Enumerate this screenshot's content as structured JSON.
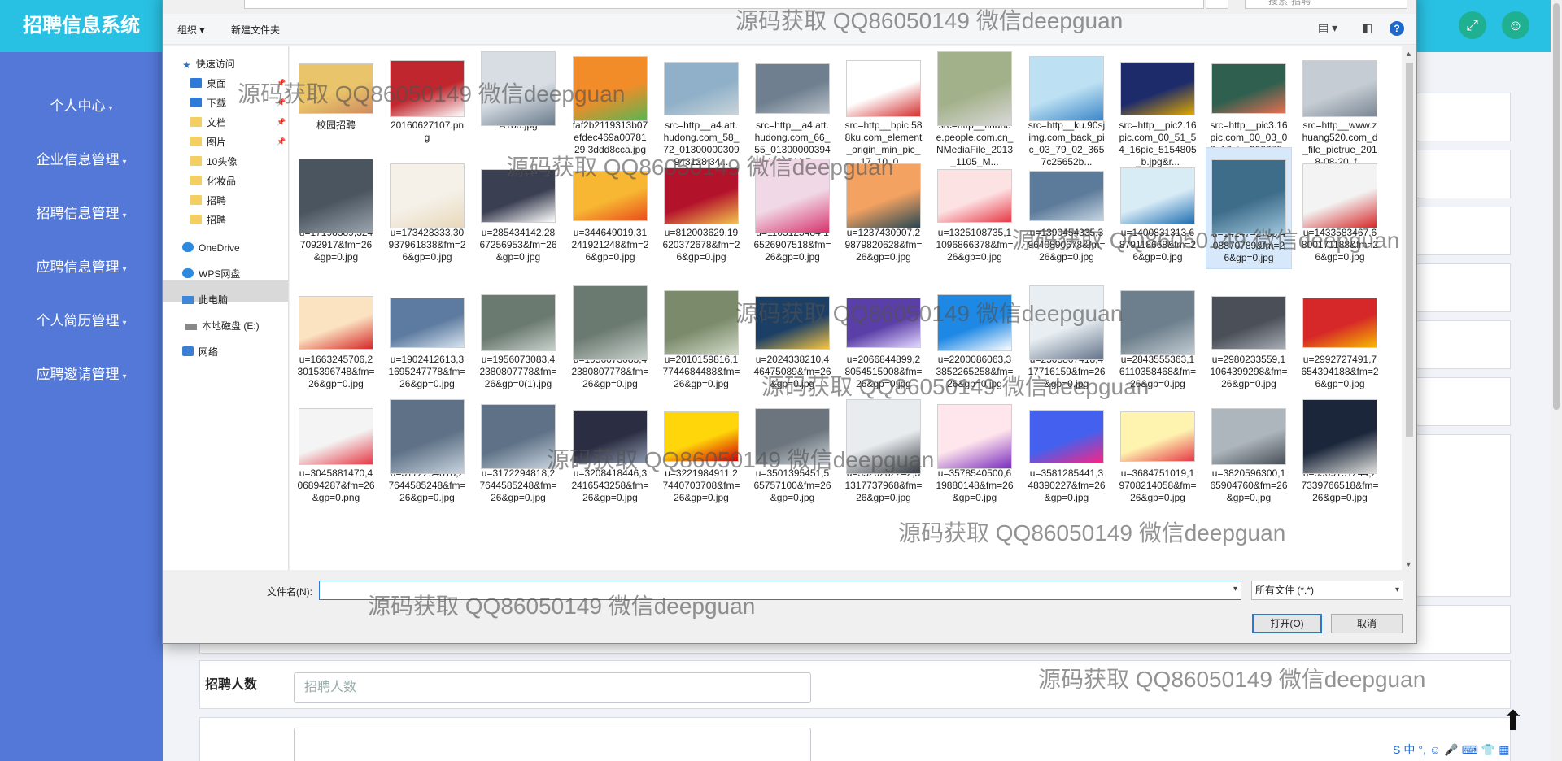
{
  "app": {
    "title": "招聘信息系统",
    "header_icons": [
      "fullscreen-icon",
      "user-icon"
    ],
    "sidebar": [
      {
        "label": "个人中心"
      },
      {
        "label": "企业信息管理"
      },
      {
        "label": "招聘信息管理"
      },
      {
        "label": "应聘信息管理"
      },
      {
        "label": "个人简历管理"
      },
      {
        "label": "应聘邀请管理"
      }
    ],
    "caret": "▾",
    "form": {
      "recruit_count_label": "招聘人数",
      "recruit_count_placeholder": "招聘人数"
    },
    "upload_icon": "⬆",
    "ime": [
      "S",
      "中",
      "°,",
      "☺",
      "🎤",
      "⌨",
      "👕",
      "▦"
    ]
  },
  "dialog": {
    "search_placeholder": "搜索\"招聘\"",
    "toolbar": {
      "organize": "组织 ▾",
      "new_folder": "新建文件夹"
    },
    "nav": [
      {
        "label": "快速访问",
        "icon": "star-icon",
        "pinned": false
      },
      {
        "label": "桌面",
        "icon": "desktop-icon",
        "pinned": true
      },
      {
        "label": "下载",
        "icon": "download-icon",
        "pinned": true
      },
      {
        "label": "文档",
        "icon": "document-icon",
        "pinned": true
      },
      {
        "label": "图片",
        "icon": "picture-icon",
        "pinned": true
      },
      {
        "label": "10头像",
        "icon": "folder-icon",
        "pinned": false
      },
      {
        "label": "化妆品",
        "icon": "folder-icon",
        "pinned": false
      },
      {
        "label": "招聘",
        "icon": "folder-icon",
        "pinned": false
      },
      {
        "label": "招聘",
        "icon": "folder-icon",
        "pinned": false
      },
      {
        "label": "OneDrive",
        "icon": "onedrive-icon",
        "pinned": false
      },
      {
        "label": "WPS网盘",
        "icon": "cloud-icon",
        "pinned": false
      },
      {
        "label": "此电脑",
        "icon": "computer-icon",
        "pinned": false
      },
      {
        "label": "本地磁盘 (E:)",
        "icon": "drive-icon",
        "pinned": false
      },
      {
        "label": "网络",
        "icon": "network-icon",
        "pinned": false
      }
    ],
    "files": [
      {
        "name": "校园招聘",
        "color": "#e9c46a",
        "sub": "#d08c60"
      },
      {
        "name": "20160627107.png",
        "color": "#c0262d",
        "sub": "#ffffff"
      },
      {
        "name": "A188.jpg",
        "color": "#d7dde3",
        "sub": "#6a7b8c"
      },
      {
        "name": "faf2b2119313b07efdec469a0078129 3ddd8cca.jpg",
        "color": "#f28c28",
        "sub": "#5ab552"
      },
      {
        "name": "src=http__a4.att.hudong.com_58_72_01300000309943128 34...",
        "color": "#8fb0c8",
        "sub": "#c9d4da"
      },
      {
        "name": "src=http__a4.att.hudong.com_66_55_013000003944181511 7...",
        "color": "#6f7f8f",
        "sub": "#b8c0c8"
      },
      {
        "name": "src=http__bpic.588ku.com_element_origin_min_pic_17_10_0...",
        "color": "#ffffff",
        "sub": "#d32f2f"
      },
      {
        "name": "src=http__finance.people.com.cn_NMediaFile_2013_1105_M...",
        "color": "#a3b18a",
        "sub": "#d9d9d9"
      },
      {
        "name": "src=http__ku.90sjimg.com_back_pic_03_79_02_3657c25652b...",
        "color": "#bde0f2",
        "sub": "#3a86c8"
      },
      {
        "name": "src=http__pic2.16pic.com_00_51_54_16pic_5154805_b.jpg&r...",
        "color": "#1d2b6b",
        "sub": "#e0a800"
      },
      {
        "name": "src=http__pic3.16pic.com_00_03_08_16pic_308378_b.jpg&ref...",
        "color": "#2f5f4f",
        "sub": "#e76f51"
      },
      {
        "name": "src=http__www.zhuang520.com_d_file_pictrue_2018-08-20_f...",
        "color": "#c5ccd3",
        "sub": "#7a8794"
      },
      {
        "name": "u=17198389,3247092917&fm=26&gp=0.jpg",
        "color": "#4a5560",
        "sub": "#9aa5ae"
      },
      {
        "name": "u=173428333,30937961838&fm=26&gp=0.jpg",
        "color": "#f5f0e8",
        "sub": "#e8d8b8"
      },
      {
        "name": "u=285434142,2867256953&fm=26&gp=0.jpg",
        "color": "#3b3f52",
        "sub": "#ffffff"
      },
      {
        "name": "u=344649019,31241921248&fm=26&gp=0.jpg",
        "color": "#f7b733",
        "sub": "#e94e1b"
      },
      {
        "name": "u=812003629,19620372678&fm=26&gp=0.jpg",
        "color": "#b3122b",
        "sub": "#f2c14e"
      },
      {
        "name": "u=1105125484,16526907518&fm=26&gp=0.jpg",
        "color": "#f1d8e6",
        "sub": "#d6336c"
      },
      {
        "name": "u=1237430907,29879820628&fm=26&gp=0.jpg",
        "color": "#f4a261",
        "sub": "#264653"
      },
      {
        "name": "u=1325108735,11096866378&fm=26&gp=0.jpg",
        "color": "#fde2e4",
        "sub": "#e63946"
      },
      {
        "name": "u=1390454335,39640890678&fm=26&gp=0.jpg",
        "color": "#5c7a99",
        "sub": "#c4d4e2"
      },
      {
        "name": "u=1400831313,6879118668&fm=26&gp=0.jpg",
        "color": "#d8ecf6",
        "sub": "#1f6fb2"
      },
      {
        "name": "u=1414742736,408870789&fm=26&gp=0.jpg",
        "color": "#3e6d8a",
        "sub": "#9fc5db",
        "selected": true
      },
      {
        "name": "u=1433583467,6800171188&fm=26&gp=0.jpg",
        "color": "#f3f3f3",
        "sub": "#d62828"
      },
      {
        "name": "u=1663245706,23015396748&fm=26&gp=0.jpg",
        "color": "#fbe3c2",
        "sub": "#d62828"
      },
      {
        "name": "u=1902412613,31695247778&fm=26&gp=0.jpg",
        "color": "#5d7ba0",
        "sub": "#d7e3ef"
      },
      {
        "name": "u=1956073083,42380807778&fm=26&gp=0(1).jpg",
        "color": "#6b7a70",
        "sub": "#c8d1cc"
      },
      {
        "name": "u=1956073083,42380807778&fm=26&gp=0.jpg",
        "color": "#6b7a70",
        "sub": "#c8d1cc"
      },
      {
        "name": "u=2010159816,17744684488&fm=26&gp=0.jpg",
        "color": "#7a8a6a",
        "sub": "#d3dbc9"
      },
      {
        "name": "u=2024338210,446475089&fm=26&gp=0.jpg",
        "color": "#1c3f66",
        "sub": "#f4c542"
      },
      {
        "name": "u=2066844899,28054515908&fm=26&gp=0.jpg",
        "color": "#5b3fa8",
        "sub": "#e3d7ff"
      },
      {
        "name": "u=2200086063,33852265258&fm=26&gp=0.jpg",
        "color": "#1e88e5",
        "sub": "#ffffff"
      },
      {
        "name": "u=2503807418,417716159&fm=26&gp=0.jpg",
        "color": "#e8eef2",
        "sub": "#64748b"
      },
      {
        "name": "u=2843555363,16110358468&fm=26&gp=0.jpg",
        "color": "#6d7f8c",
        "sub": "#c2ccd3"
      },
      {
        "name": "u=2980233559,11064399298&fm=26&gp=0.jpg",
        "color": "#4a4f58",
        "sub": "#a8adb5"
      },
      {
        "name": "u=2992727491,7654394188&fm=26&gp=0.jpg",
        "color": "#d62828",
        "sub": "#f7b801"
      },
      {
        "name": "u=3045881470,406894287&fm=26&gp=0.png",
        "color": "#f4f4f4",
        "sub": "#e63946"
      },
      {
        "name": "u=3172294818,27644585248&fm=26&gp=0.jpg",
        "color": "#5e7186",
        "sub": "#c8d3de"
      },
      {
        "name": "u=3172294818,27644585248&fm=26&gp=0.jpg",
        "color": "#5e7186",
        "sub": "#c8d3de"
      },
      {
        "name": "u=3208418446,32416543258&fm=26&gp=0.jpg",
        "color": "#2b2d42",
        "sub": "#8d99ae"
      },
      {
        "name": "u=3221984911,27440703708&fm=26&gp=0.jpg",
        "color": "#ffd60a",
        "sub": "#d00000"
      },
      {
        "name": "u=3501395451,565757100&fm=26&gp=0.jpg",
        "color": "#6c757d",
        "sub": "#ced4da"
      },
      {
        "name": "u=3520282242,31317737968&fm=26&gp=0.jpg",
        "color": "#e9ecef",
        "sub": "#343a40"
      },
      {
        "name": "u=3578540500,619880148&fm=26&gp=0.jpg",
        "color": "#ffe5ec",
        "sub": "#7b2cbf"
      },
      {
        "name": "u=3581285441,348390227&fm=26&gp=0.jpg",
        "color": "#4361ee",
        "sub": "#f72585"
      },
      {
        "name": "u=3684751019,19708214058&fm=26&gp=0.jpg",
        "color": "#fff3b0",
        "sub": "#e63946"
      },
      {
        "name": "u=3820596300,165904760&fm=26&gp=0.jpg",
        "color": "#adb5bd",
        "sub": "#495057"
      },
      {
        "name": "u=3909151244,27339766518&fm=26&gp=0.jpg",
        "color": "#1b263b",
        "sub": "#e0e1dd"
      }
    ],
    "filename_label": "文件名(N):",
    "filename_value": "",
    "filetype": "所有文件 (*.*)",
    "open_label": "打开(O)",
    "cancel_label": "取消"
  },
  "watermark": "源码获取 QQ86050149 微信deepguan"
}
